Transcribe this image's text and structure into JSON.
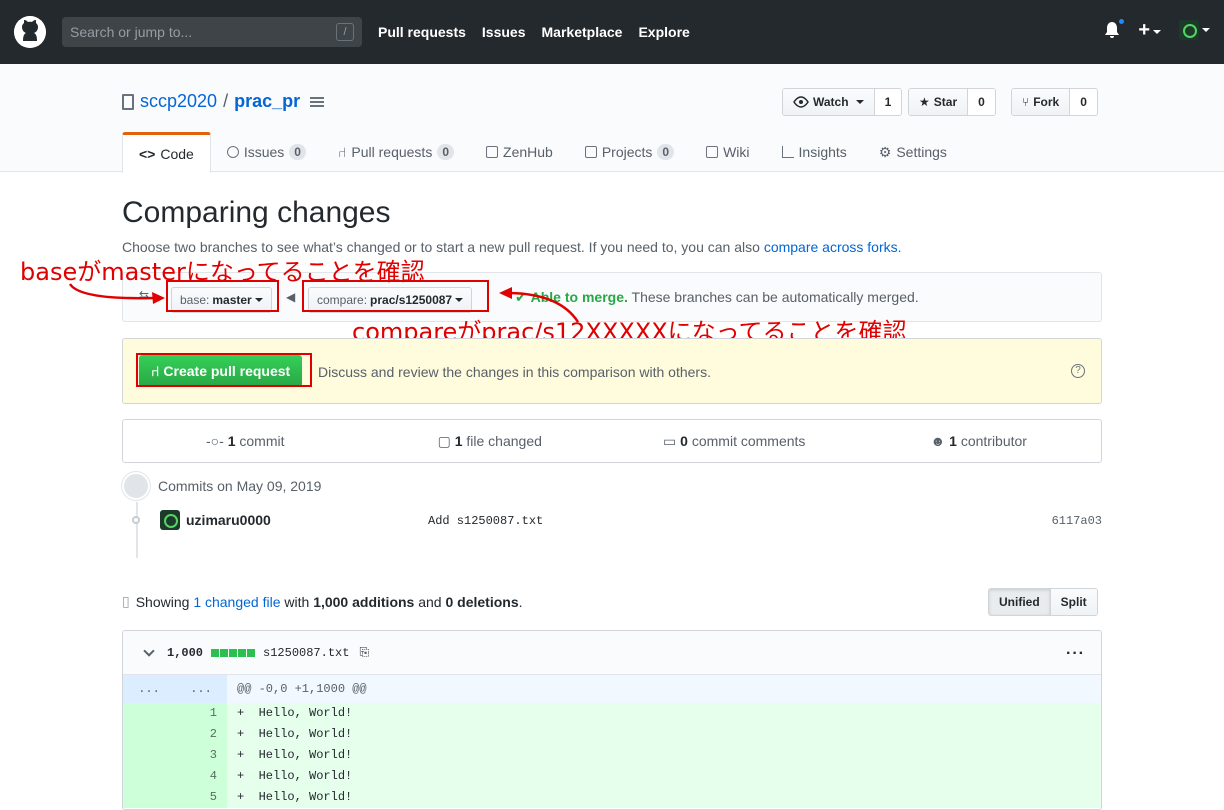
{
  "header": {
    "search_placeholder": "Search or jump to...",
    "slash": "/",
    "nav": [
      "Pull requests",
      "Issues",
      "Marketplace",
      "Explore"
    ],
    "plus": "+"
  },
  "repo": {
    "owner": "sccp2020",
    "sep": "/",
    "name": "prac_pr",
    "watch": "Watch",
    "watch_count": "1",
    "star": "Star",
    "star_count": "0",
    "fork": "Fork",
    "fork_count": "0"
  },
  "tabs": [
    {
      "label": "Code"
    },
    {
      "label": "Issues",
      "badge": "0"
    },
    {
      "label": "Pull requests",
      "badge": "0"
    },
    {
      "label": "ZenHub"
    },
    {
      "label": "Projects",
      "badge": "0"
    },
    {
      "label": "Wiki"
    },
    {
      "label": "Insights"
    },
    {
      "label": "Settings"
    }
  ],
  "compare": {
    "title": "Comparing changes",
    "subtitle": "Choose two branches to see what’s changed or to start a new pull request. If you need to, you can also ",
    "subtitle_link": "compare across forks",
    "subtitle_end": ".",
    "base_label": "base:",
    "base_value": "master",
    "compare_label": "compare:",
    "compare_value": "prac/s1250087",
    "merge_status": "Able to merge.",
    "merge_text": " These branches can be automatically merged."
  },
  "annotations": {
    "base_note": "baseがmasterになってることを確認",
    "compare_note": "compareがprac/s12XXXXXになってることを確認"
  },
  "pr": {
    "button": "Create pull request",
    "text": "Discuss and review the changes in this comparison with others.",
    "help": "?"
  },
  "stats": {
    "commits_n": "1",
    "commits": " commit",
    "files_n": "1",
    "files": " file changed",
    "comments_n": "0",
    "comments": " commit comments",
    "contrib_n": "1",
    "contrib": " contributor"
  },
  "commits": {
    "date": "Commits on May 09, 2019",
    "author": "uzimaru0000",
    "message": "Add s1250087.txt",
    "sha": "6117a03"
  },
  "diff": {
    "showing": "Showing ",
    "changed": "1 changed file",
    "with": " with ",
    "additions": "1,000 additions",
    "and": " and ",
    "deletions": "0 deletions",
    "end": ".",
    "unified": "Unified",
    "split": "Split",
    "count": "1,000",
    "filename": "s1250087.txt",
    "kebab": "···",
    "hunk_l": "...",
    "hunk_r": "...",
    "hunk": "@@ -0,0 +1,1000 @@",
    "lines": [
      {
        "n": "1",
        "t": "+  Hello, World!"
      },
      {
        "n": "2",
        "t": "+  Hello, World!"
      },
      {
        "n": "3",
        "t": "+  Hello, World!"
      },
      {
        "n": "4",
        "t": "+  Hello, World!"
      },
      {
        "n": "5",
        "t": "+  Hello, World!"
      }
    ]
  },
  "colors": {
    "accent_red": "#e00000",
    "green": "#28a745",
    "link": "#0366d6"
  }
}
